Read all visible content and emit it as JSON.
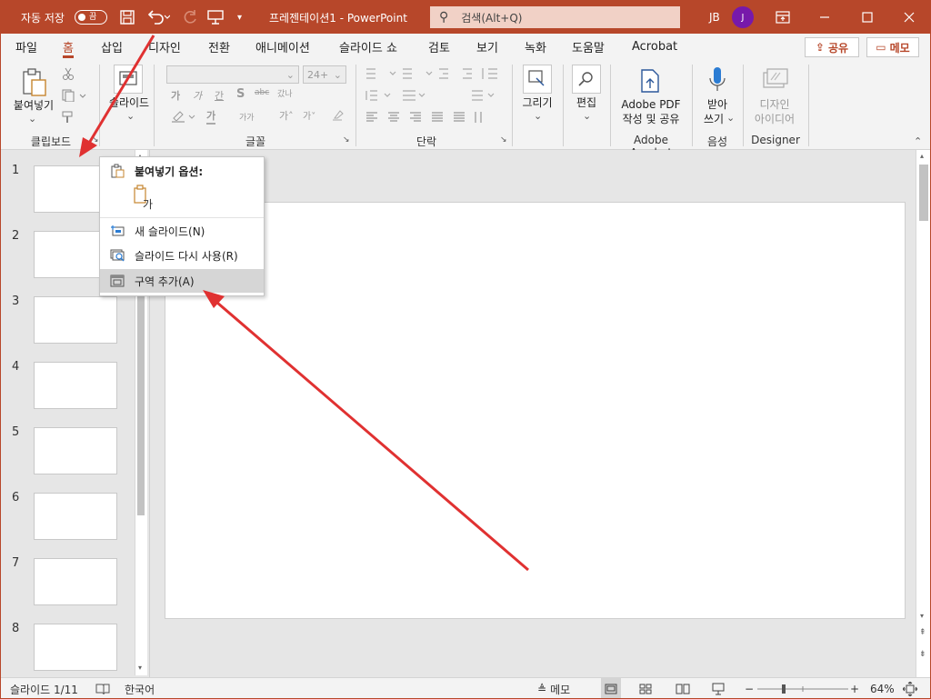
{
  "titlebar": {
    "autosave_label": "자동 저장",
    "autosave_toggle": "끔",
    "doc_title": "프레젠테이션1  -  PowerPoint",
    "search_placeholder": "검색(Alt+Q)",
    "user_initials": "JB",
    "avatar_letter": "J",
    "brand_color": "#b7472a"
  },
  "tabs": [
    {
      "label": "파일"
    },
    {
      "label": "홈",
      "active": true
    },
    {
      "label": "삽입"
    },
    {
      "label": "디자인"
    },
    {
      "label": "전환"
    },
    {
      "label": "애니메이션"
    },
    {
      "label": "슬라이드 쇼"
    },
    {
      "label": "검토"
    },
    {
      "label": "보기"
    },
    {
      "label": "녹화"
    },
    {
      "label": "도움말"
    },
    {
      "label": "Acrobat"
    }
  ],
  "tab_actions": {
    "share": "공유",
    "comment": "메모"
  },
  "ribbon": {
    "clipboard": {
      "paste": "붙여넣기",
      "group": "클립보드"
    },
    "slides": {
      "slide": "슬라이드",
      "group": ""
    },
    "font": {
      "size": "24+",
      "group": "글꼴",
      "row2": [
        "가",
        "가",
        "간",
        "S",
        "abc",
        "갔나"
      ],
      "row3": [
        "가",
        "가가",
        "가˄",
        "가˅"
      ]
    },
    "paragraph": {
      "group": "단락"
    },
    "drawing": {
      "label": "그리기"
    },
    "editing": {
      "label": "편집"
    },
    "adobe": {
      "line1": "Adobe PDF",
      "line2": "작성 및 공유",
      "group": "Adobe Acrobat"
    },
    "voice": {
      "line1": "받아",
      "line2": "쓰기",
      "group": "음성"
    },
    "designer": {
      "line1": "디자인",
      "line2": "아이디어",
      "group": "Designer"
    }
  },
  "thumbnails": [
    "1",
    "2",
    "3",
    "4",
    "5",
    "6",
    "7",
    "8"
  ],
  "context_menu": {
    "header": "붙여넣기 옵션:",
    "items": [
      {
        "label": "새 슬라이드(N)",
        "icon": "new-slide-icon"
      },
      {
        "label": "슬라이드 다시 사용(R)",
        "icon": "reuse-slides-icon"
      },
      {
        "label": "구역 추가(A)",
        "icon": "add-section-icon",
        "highlighted": true
      }
    ]
  },
  "statusbar": {
    "slide_count": "슬라이드 1/11",
    "language": "한국어",
    "notes": "메모",
    "zoom": "64%"
  },
  "annotation_color": "#e03131"
}
